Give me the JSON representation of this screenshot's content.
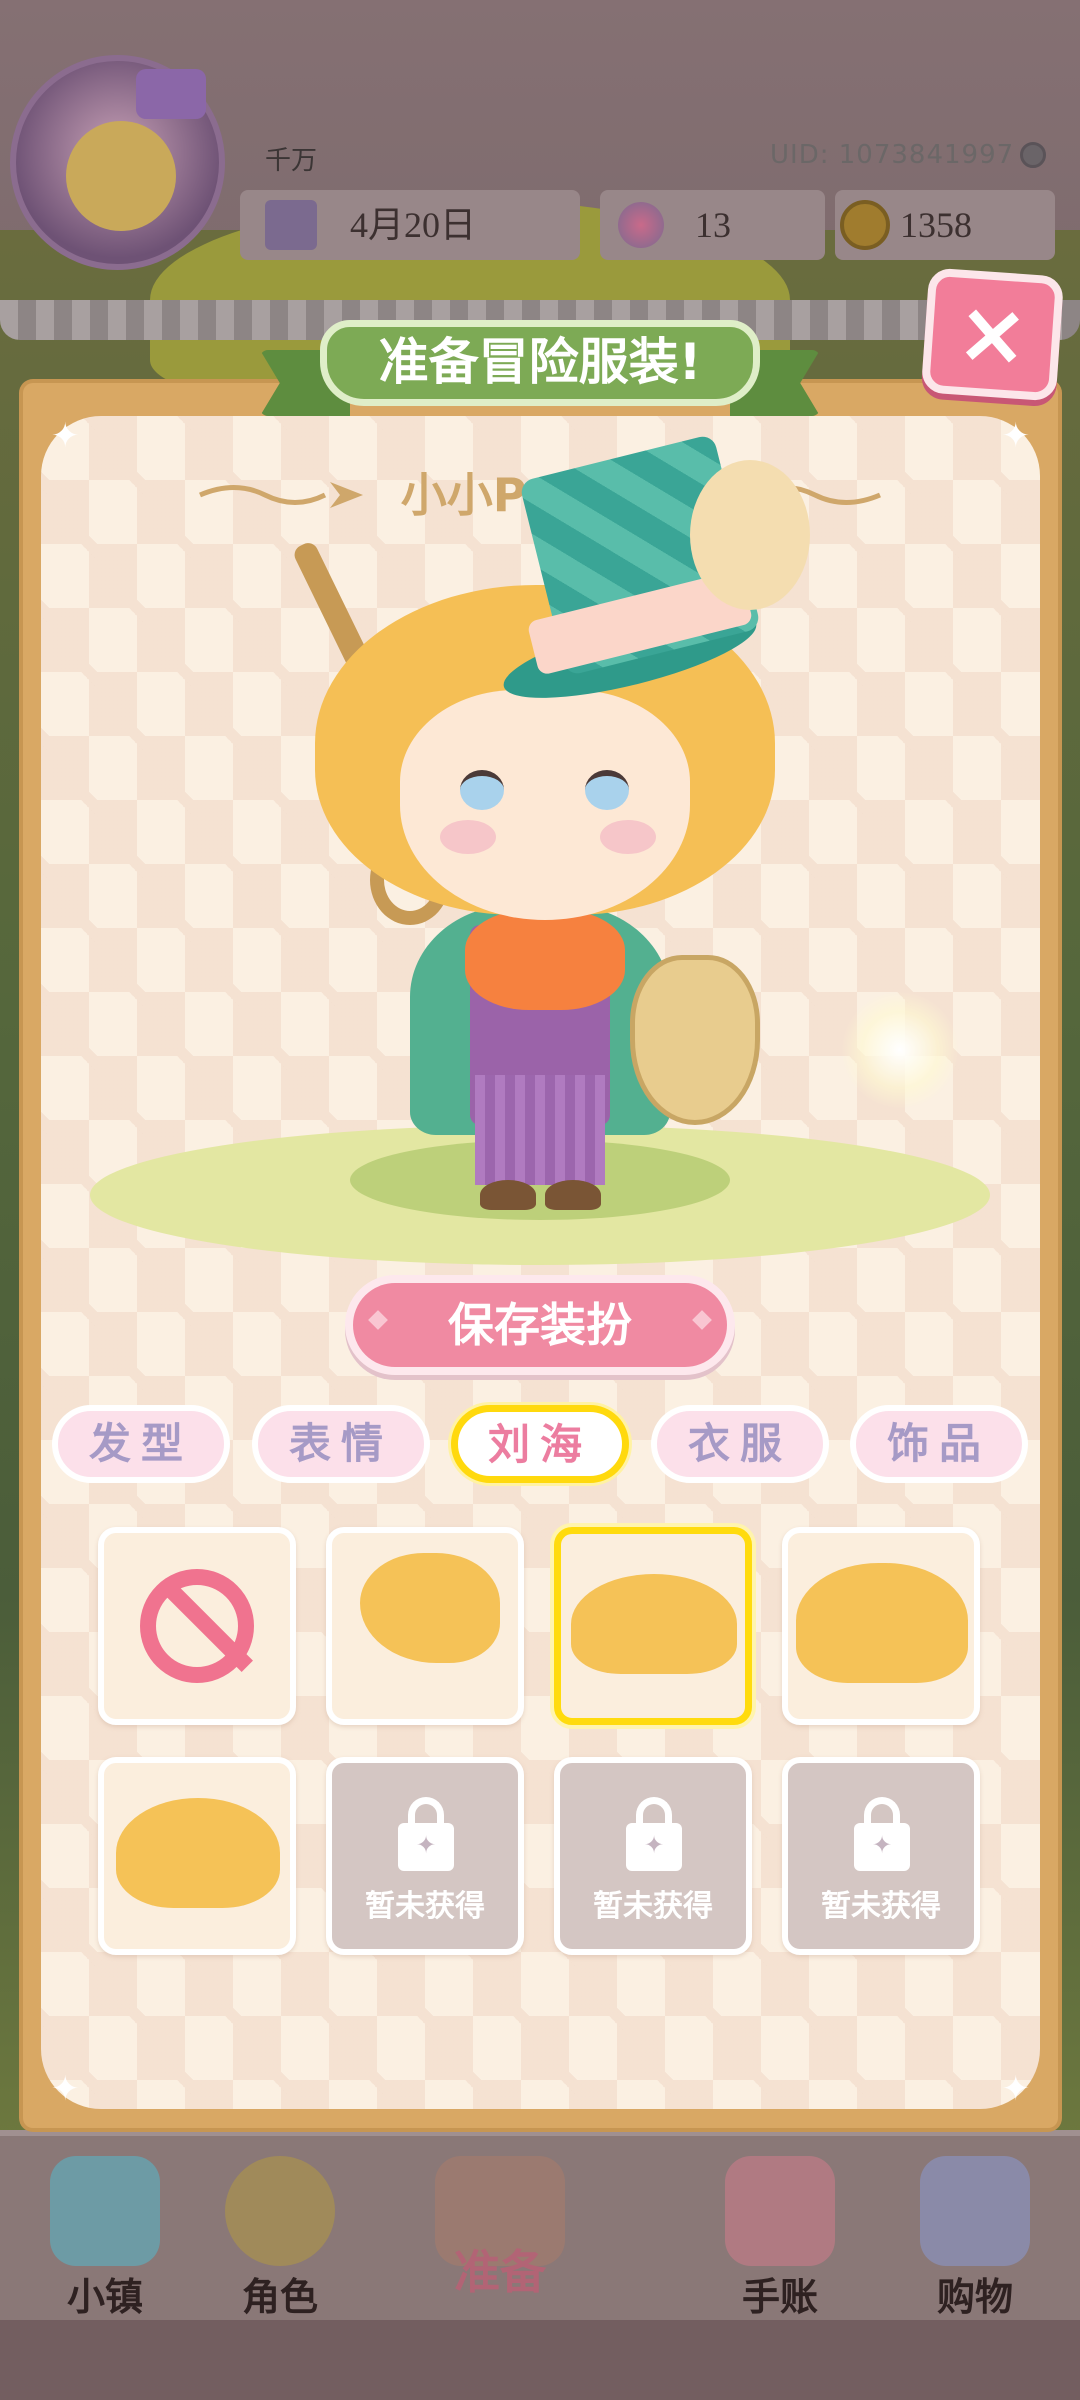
{
  "header": {
    "user_name": "千万",
    "uid": "UID: 1073841997",
    "date": "4月20日",
    "gems": "13",
    "coins": "1358"
  },
  "dialog": {
    "title": "准备冒险服装!",
    "character_name": "小小Peacoo",
    "close_label": "×",
    "save_button": "保存装扮",
    "tabs": [
      {
        "label": "发型",
        "active": false
      },
      {
        "label": "表情",
        "active": false
      },
      {
        "label": "刘海",
        "active": true
      },
      {
        "label": "衣服",
        "active": false
      },
      {
        "label": "饰品",
        "active": false
      }
    ],
    "items": [
      {
        "kind": "none",
        "selected": false
      },
      {
        "kind": "bangs-1",
        "selected": false
      },
      {
        "kind": "bangs-2",
        "selected": true
      },
      {
        "kind": "bangs-3",
        "selected": false
      },
      {
        "kind": "bangs-4",
        "selected": false
      },
      {
        "kind": "locked",
        "label": "暂未获得"
      },
      {
        "kind": "locked",
        "label": "暂未获得"
      },
      {
        "kind": "locked",
        "label": "暂未获得"
      }
    ]
  },
  "bottom_nav": [
    {
      "label": "小镇",
      "icon": "town-map-icon"
    },
    {
      "label": "角色",
      "icon": "character-icon"
    },
    {
      "label": "准备",
      "icon": "prepare-icon"
    },
    {
      "label": "手账",
      "icon": "journal-icon"
    },
    {
      "label": "购物",
      "icon": "shopping-bag-icon"
    }
  ],
  "colors": {
    "accent_pink": "#f08aa2",
    "selected_yellow": "#ffd90d",
    "banner_green": "#7daa55",
    "frame_tan": "#d9a864"
  }
}
